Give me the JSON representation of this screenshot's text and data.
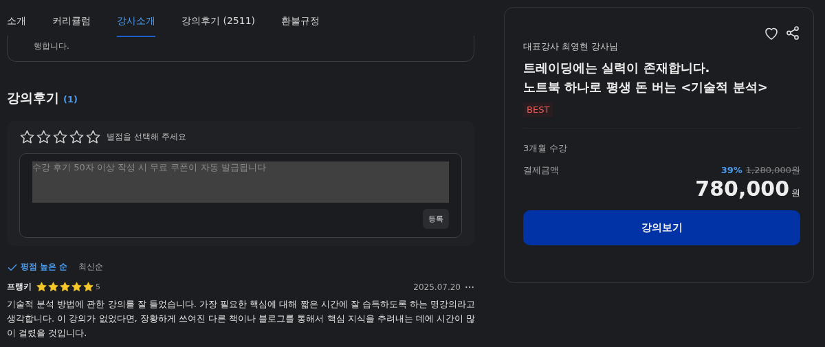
{
  "tabs": [
    {
      "label": "소개",
      "selected": false
    },
    {
      "label": "커리큘럼",
      "selected": false
    },
    {
      "label": "강사소개",
      "selected": true
    },
    {
      "label": "강의후기 (2511)",
      "selected": false
    },
    {
      "label": "환불규정",
      "selected": false
    }
  ],
  "intro_tail": "행합니다.",
  "reviews_section": {
    "title": "강의후기",
    "count": "(1)",
    "form": {
      "stars": 0,
      "hint": "별점을 선택해 주세요",
      "placeholder": "수강 후기 50자 이상 작성 시 무료 쿠폰이 자동 발급됩니다",
      "submit": "등록"
    },
    "sort": [
      {
        "label": "평점 높은 순",
        "selected": true
      },
      {
        "label": "최신순",
        "selected": false
      }
    ],
    "reviews": [
      {
        "author": "프랭키",
        "stars": 5,
        "rating": "5",
        "date": "2025.07.20",
        "text": "기술적 분석 방법에 관한 강의를 잘 들었습니다. 가장 필요한 핵심에 대해 짧은 시간에 잘 습득하도록 하는 명강의라고 생각합니다. 이 강의가 없었다면, 장황하게 쓰여진 다른 책이나 블로그를 통해서 핵심 지식을 추려내는 데에 시간이 많이 걸렸을 것입니다."
      }
    ]
  },
  "course_card": {
    "instructor": "대표강사 최영현 강사님",
    "title_lines": [
      "트레이딩에는 실력이 존재합니다.",
      "노트북 하나로 평생 돈 버는 <기술적 분석>"
    ],
    "badge": "BEST",
    "period": "3개월 수강",
    "price_label": "결제금액",
    "discount": "39%",
    "original_price": "1,280,000원",
    "price": "780,000",
    "currency": "원",
    "cta": "강의보기"
  }
}
